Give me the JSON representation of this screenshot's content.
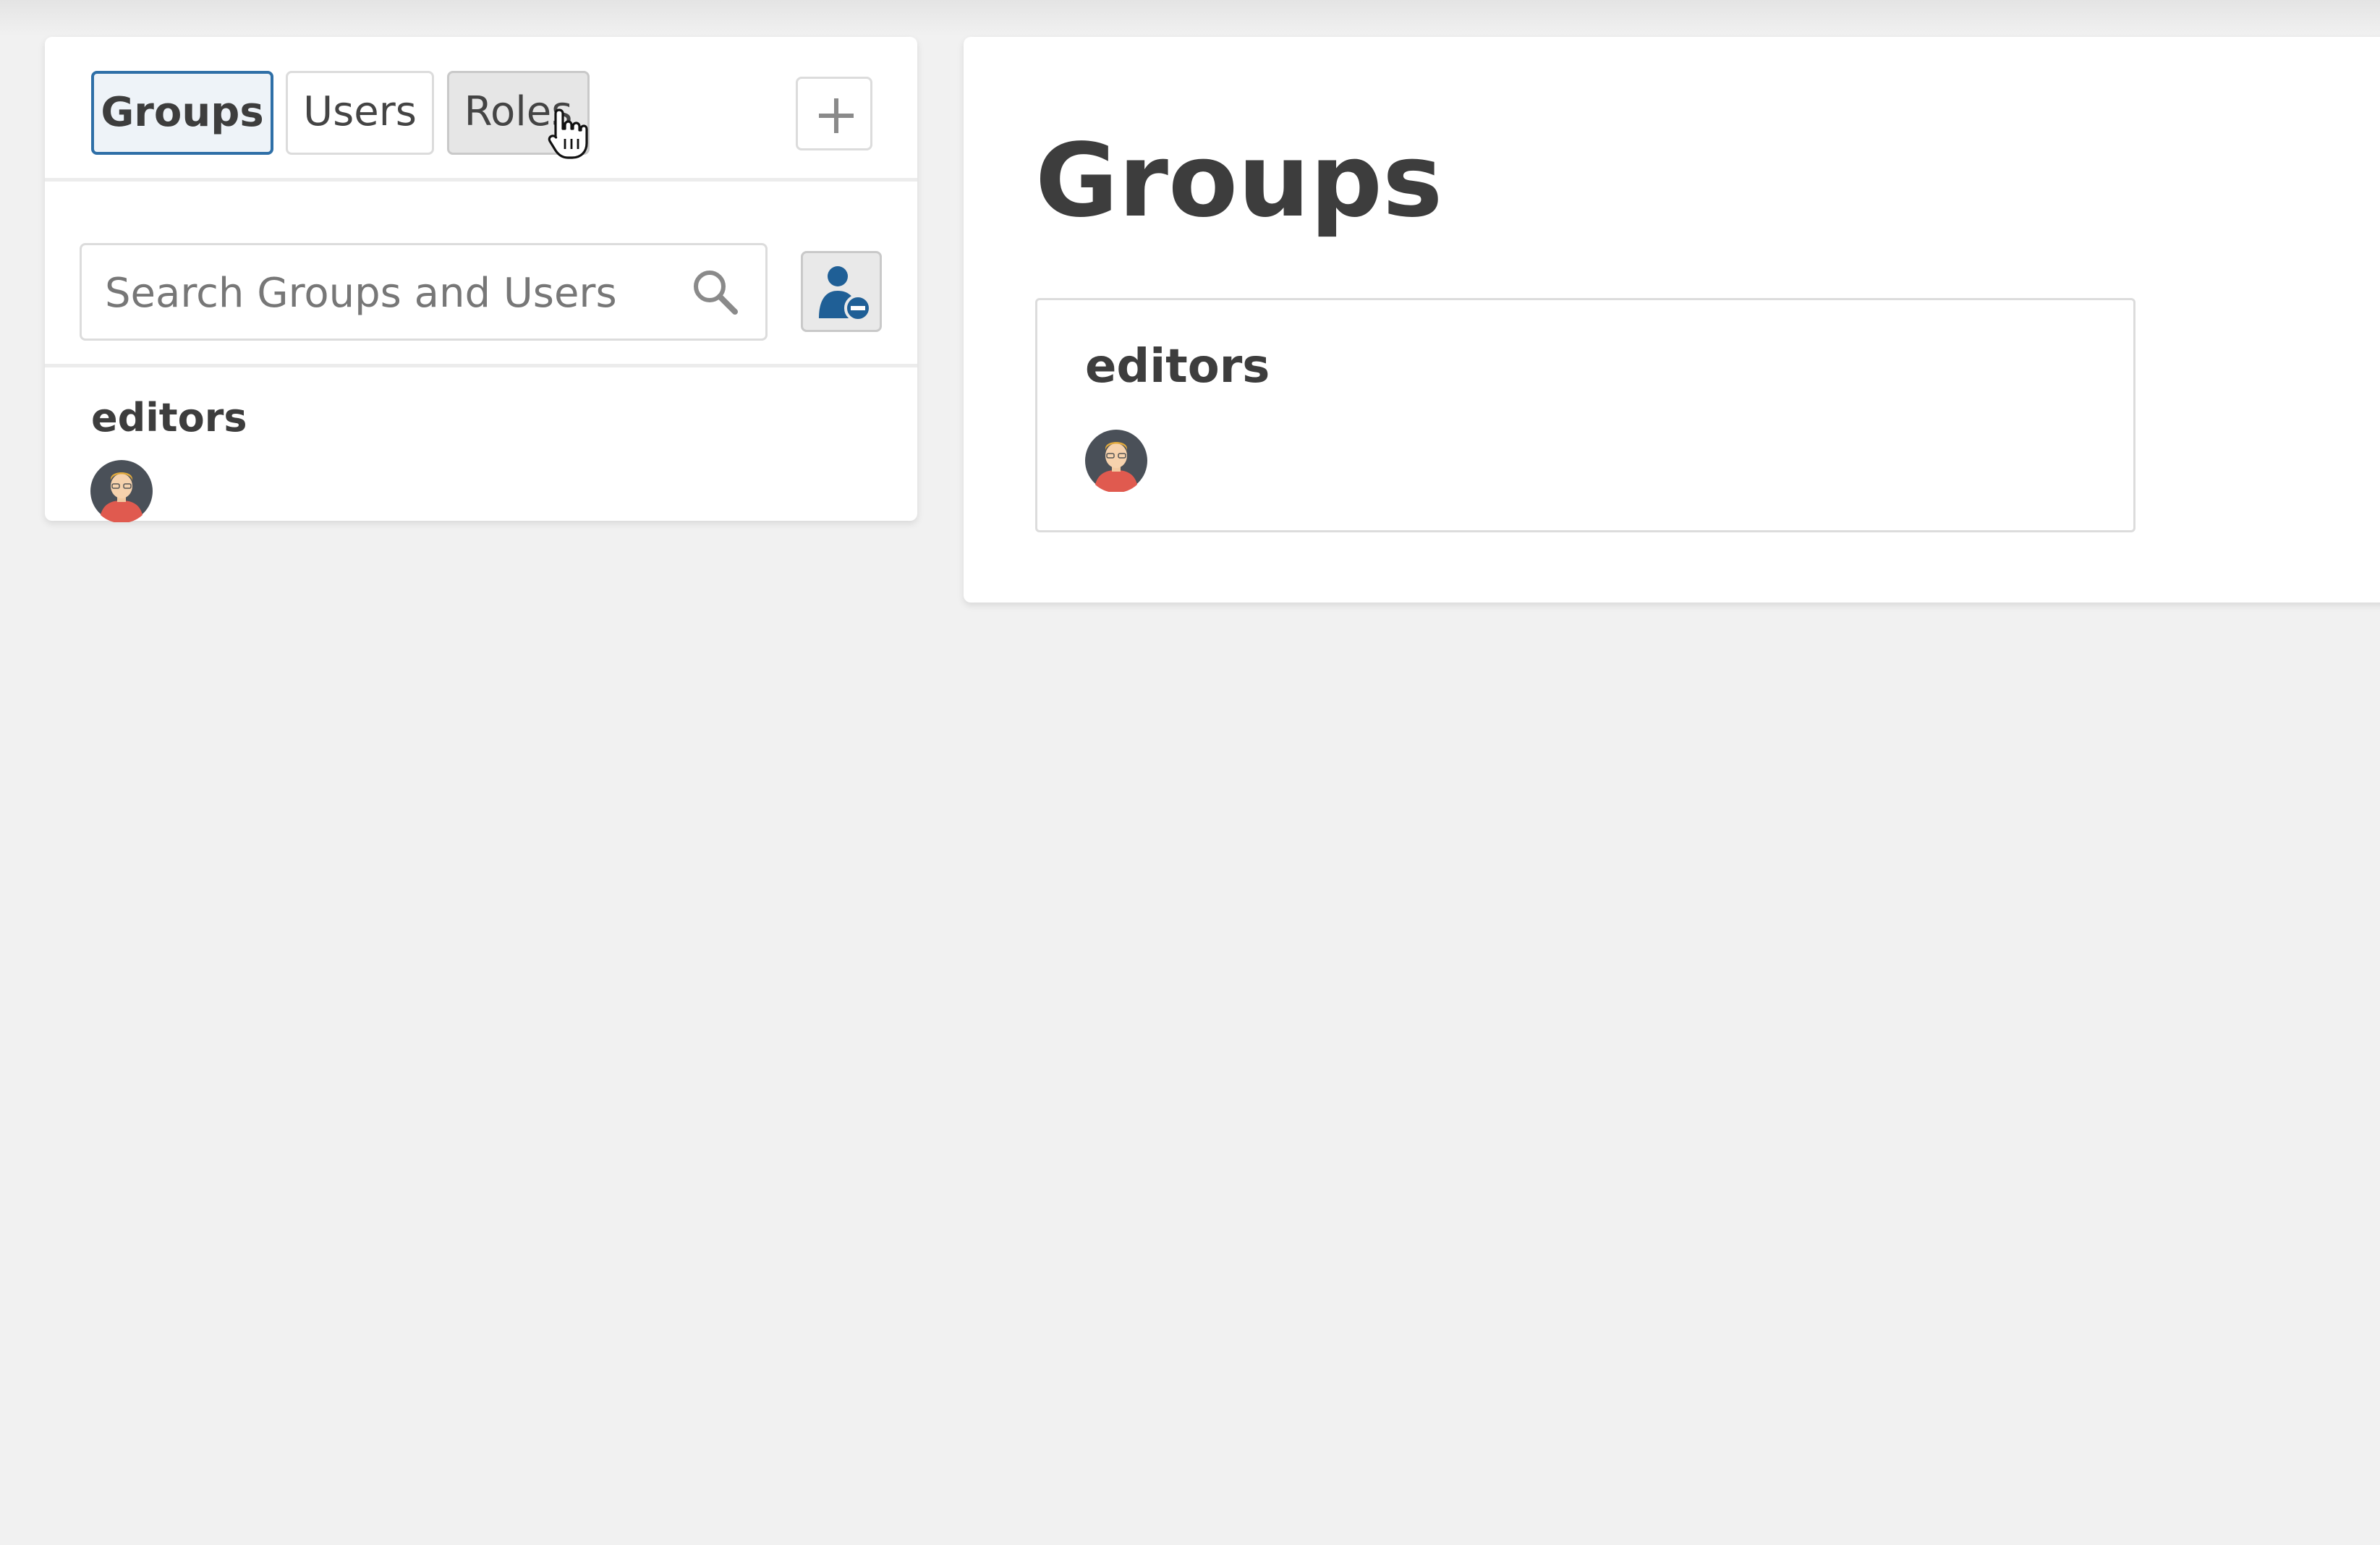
{
  "sidebar": {
    "tabs": [
      {
        "label": "Groups",
        "active": true
      },
      {
        "label": "Users",
        "active": false
      },
      {
        "label": "Roles",
        "active": false,
        "hovered": true
      }
    ],
    "add_icon": "plus-icon",
    "search": {
      "placeholder": "Search Groups and Users",
      "value": "",
      "icon": "search-icon"
    },
    "user_remove_icon": "user-minus-icon",
    "list": [
      {
        "name": "editors",
        "member_icon": "avatar"
      }
    ]
  },
  "main": {
    "title": "Groups",
    "groups": [
      {
        "name": "editors",
        "member_icon": "avatar"
      }
    ]
  },
  "colors": {
    "background": "#f1f1f1",
    "panel": "#ffffff",
    "accent": "#2e6fa7",
    "text": "#3d3d3d",
    "border": "#dcdcdc"
  }
}
